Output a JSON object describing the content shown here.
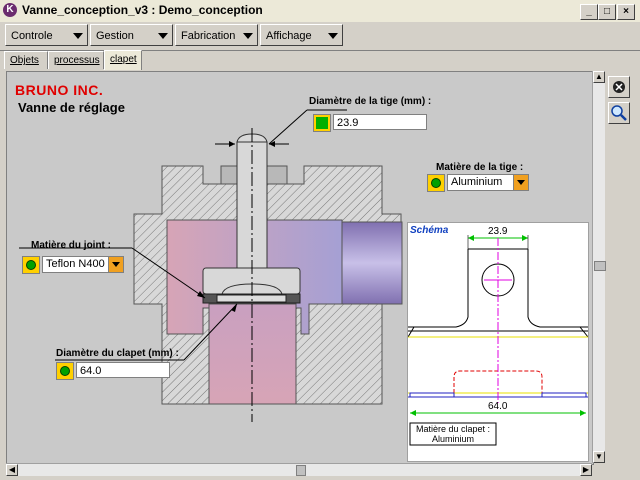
{
  "window": {
    "title": "Vanne_conception_v3 : Demo_conception",
    "app_icon_letter": "K"
  },
  "menus": [
    {
      "label": "Controle"
    },
    {
      "label": "Gestion"
    },
    {
      "label": "Fabrication"
    },
    {
      "label": "Affichage"
    }
  ],
  "tabs": [
    {
      "label": "Objets"
    },
    {
      "label": "processus"
    },
    {
      "label": "clapet",
      "active": true
    }
  ],
  "drawing": {
    "brand": "BRUNO INC.",
    "title": "Vanne de réglage",
    "stem_diameter": {
      "label": "Diamètre de la tige (mm) :",
      "value": "23.9"
    },
    "stem_material": {
      "label": "Matière de la tige :",
      "value": "Aluminium"
    },
    "seal_material": {
      "label": "Matière du joint :",
      "value": "Teflon N400"
    },
    "valve_diameter": {
      "label": "Diamètre du clapet (mm) :",
      "value": "64.0"
    }
  },
  "schema": {
    "title": "Schéma",
    "top_dimension": "23.9",
    "bottom_dimension": "64.0",
    "caption_line1": "Matière du clapet :",
    "caption_line2": "Aluminium"
  },
  "side_tools": [
    {
      "icon": "close-circle-icon"
    },
    {
      "icon": "magnifier-icon"
    }
  ],
  "colors": {
    "brand": "#e00000",
    "schema_title": "#1040c0",
    "dimension": "#00c000",
    "axis": "#e000e0"
  }
}
